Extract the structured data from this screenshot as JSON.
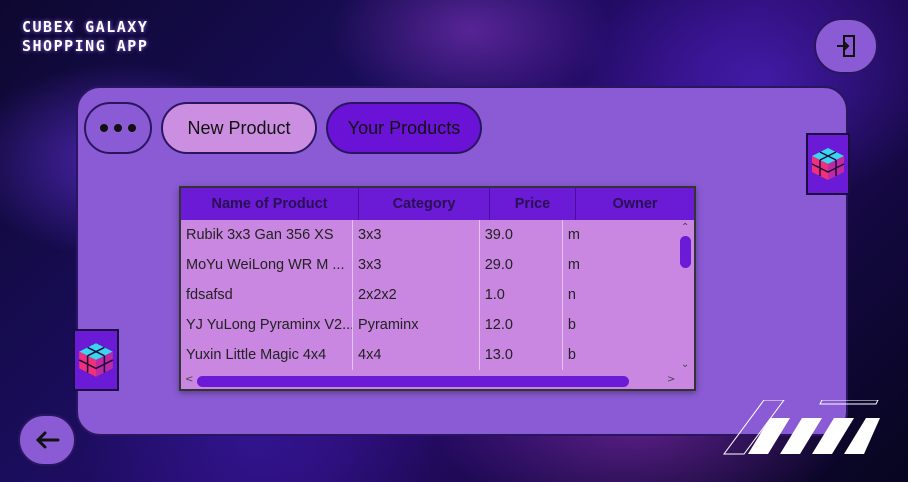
{
  "app": {
    "title_line1": "CUBEX GALAXY",
    "title_line2": "SHOPPING APP"
  },
  "toolbar": {
    "menu_icon": "more-dots-icon",
    "new_product_label": "New Product",
    "your_products_label": "Your Products"
  },
  "nav": {
    "logout_icon": "logout-icon",
    "back_icon": "arrow-left-icon"
  },
  "table": {
    "columns": [
      "Name of Product",
      "Category",
      "Price",
      "Owner"
    ],
    "rows": [
      [
        "Rubik 3x3 Gan 356 XS",
        "3x3",
        "39.0",
        "m"
      ],
      [
        "MoYu WeiLong WR M ...",
        "3x3",
        "29.0",
        "m"
      ],
      [
        "fdsafsd",
        "2x2x2",
        "1.0",
        "n"
      ],
      [
        "YJ YuLong Pyraminx V2...",
        "Pyraminx",
        "12.0",
        "b"
      ],
      [
        "Yuxin Little Magic 4x4",
        "4x4",
        "13.0",
        "b"
      ]
    ]
  },
  "colors": {
    "card": "#8a5bd4",
    "accent": "#6b1ad6",
    "table_bg": "#c987e1",
    "new_product_bg": "#cb8ee0"
  }
}
